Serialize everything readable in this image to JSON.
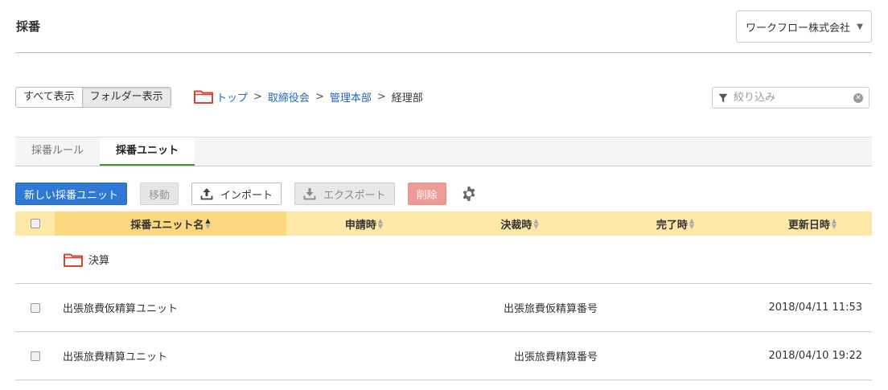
{
  "header": {
    "title": "採番",
    "company": "ワークフロー株式会社"
  },
  "view_toggle": {
    "all": "すべて表示",
    "folder": "フォルダー表示"
  },
  "breadcrumb": {
    "items": [
      "トップ",
      "取締役会",
      "管理本部"
    ],
    "separator": ">",
    "current": "経理部"
  },
  "filter": {
    "placeholder": "絞り込み"
  },
  "tabs": [
    {
      "label": "採番ルール",
      "active": false
    },
    {
      "label": "採番ユニット",
      "active": true
    }
  ],
  "toolbar": {
    "new_label": "新しい採番ユニット",
    "move_label": "移動",
    "import_label": "インポート",
    "export_label": "エクスポート",
    "delete_label": "削除"
  },
  "table": {
    "columns": [
      "採番ユニット名",
      "申請時",
      "決裁時",
      "完了時",
      "更新日時"
    ],
    "folder": "決算",
    "rows": [
      {
        "name": "出張旅費仮精算ユニット",
        "request": "",
        "approval": "出張旅費仮精算番号",
        "completion": "",
        "updated": "2018/04/11 11:53"
      },
      {
        "name": "出張旅費精算ユニット",
        "request": "",
        "approval": "出張旅費精算番号",
        "completion": "",
        "updated": "2018/04/10 19:22"
      }
    ]
  },
  "colors": {
    "accent": "#2f78d6",
    "header_bg": "#fde8a8",
    "sorted_bg": "#fbd880",
    "folder": "#d9432f",
    "tab_underline": "#3a9a3a",
    "danger": "#ee9a95"
  },
  "icons": {
    "folder": "folder-icon",
    "filter": "filter-icon",
    "upload": "upload-icon",
    "download": "download-icon",
    "settings": "gear-icon"
  }
}
